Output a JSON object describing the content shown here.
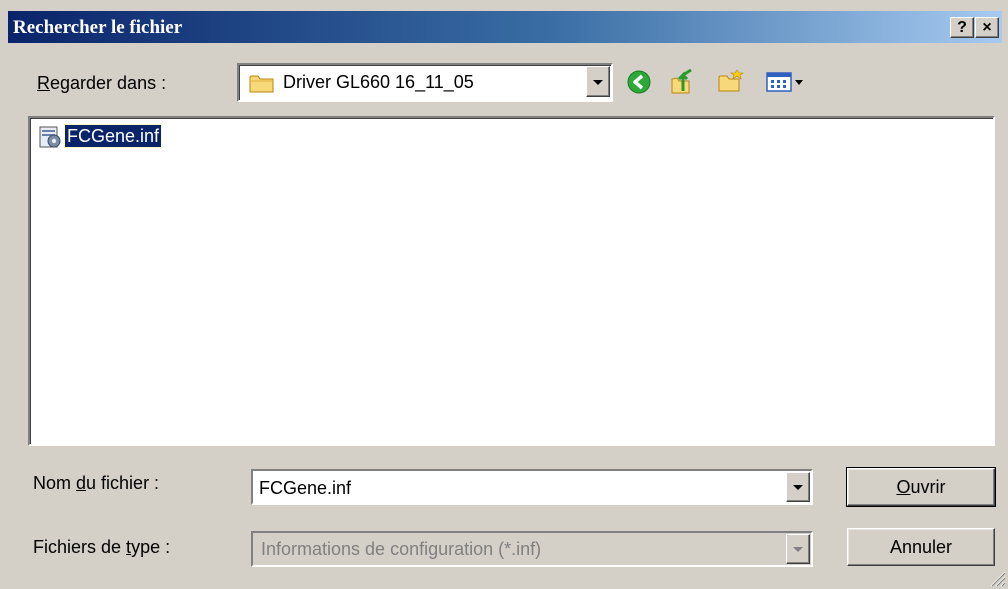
{
  "window": {
    "title": "Rechercher le fichier",
    "help_button": "?",
    "close_button": "×"
  },
  "lookin": {
    "label_prefix": "",
    "label_underlined": "R",
    "label_rest": "egarder dans :",
    "value": "Driver GL660 16_11_05",
    "toolbar_icons": [
      "back-icon",
      "up-folder-icon",
      "new-folder-icon",
      "view-menu-icon"
    ]
  },
  "files": [
    {
      "name": "FCGene.inf",
      "icon": "inf-file-icon",
      "selected": true
    }
  ],
  "filename": {
    "label_prefix": "Nom ",
    "label_underlined": "d",
    "label_rest": "u fichier :",
    "value": "FCGene.inf"
  },
  "filetype": {
    "label_prefix": "Fichiers de ",
    "label_underlined": "t",
    "label_rest": "ype :",
    "value": "Informations de configuration (*.inf)",
    "disabled": true
  },
  "buttons": {
    "open_underlined": "O",
    "open_rest": "uvrir",
    "cancel": "Annuler"
  },
  "colors": {
    "titlebar_start": "#0a246a",
    "titlebar_end": "#a6caf0",
    "dialog_bg": "#d4d0c8",
    "selection": "#0a246a"
  }
}
